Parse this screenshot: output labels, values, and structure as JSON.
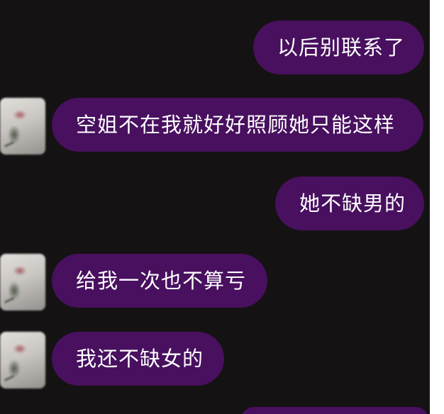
{
  "messages": [
    {
      "id": "m1",
      "sender": "me",
      "text": "以后别联系了"
    },
    {
      "id": "m2",
      "sender": "other",
      "text": "空姐不在我就好好照顾她只能这样"
    },
    {
      "id": "m3",
      "sender": "me",
      "text": "她不缺男的"
    },
    {
      "id": "m4",
      "sender": "other",
      "text": "给我一次也不算亏"
    },
    {
      "id": "m5",
      "sender": "other",
      "text": "我还不缺女的"
    }
  ],
  "colors": {
    "background": "#151213",
    "bubble": "#48105f",
    "bubble_text": "#ffffff",
    "edge_strip": "#ffffff"
  }
}
